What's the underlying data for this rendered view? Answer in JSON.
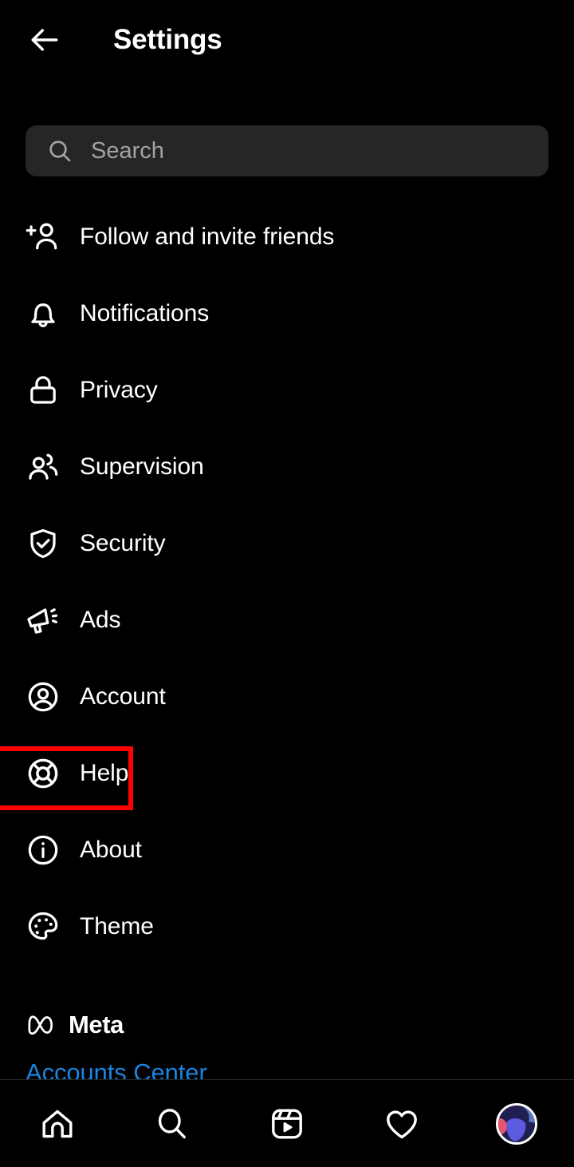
{
  "header": {
    "back_icon": "arrow-left-icon",
    "title": "Settings"
  },
  "search": {
    "icon": "search-icon",
    "value": "",
    "placeholder": "Search"
  },
  "menu": {
    "items": [
      {
        "id": "follow-and-invite-friends",
        "label": "Follow and invite friends",
        "icon": "person-add-icon",
        "highlighted": false
      },
      {
        "id": "notifications",
        "label": "Notifications",
        "icon": "bell-icon",
        "highlighted": false
      },
      {
        "id": "privacy",
        "label": "Privacy",
        "icon": "lock-icon",
        "highlighted": false
      },
      {
        "id": "supervision",
        "label": "Supervision",
        "icon": "people-icon",
        "highlighted": false
      },
      {
        "id": "security",
        "label": "Security",
        "icon": "shield-check-icon",
        "highlighted": false
      },
      {
        "id": "ads",
        "label": "Ads",
        "icon": "megaphone-icon",
        "highlighted": false
      },
      {
        "id": "account",
        "label": "Account",
        "icon": "account-circle-icon",
        "highlighted": false
      },
      {
        "id": "help",
        "label": "Help",
        "icon": "lifebuoy-icon",
        "highlighted": true
      },
      {
        "id": "about",
        "label": "About",
        "icon": "info-circle-icon",
        "highlighted": false
      },
      {
        "id": "theme",
        "label": "Theme",
        "icon": "palette-icon",
        "highlighted": false
      }
    ]
  },
  "footer": {
    "brand_icon": "meta-infinity-icon",
    "brand_label": "Meta",
    "accounts_center_label": "Accounts Center"
  },
  "bottom_nav": {
    "items": [
      {
        "id": "home",
        "icon": "home-icon"
      },
      {
        "id": "search",
        "icon": "search-icon"
      },
      {
        "id": "reels",
        "icon": "reels-icon"
      },
      {
        "id": "activity",
        "icon": "heart-icon"
      },
      {
        "id": "profile",
        "icon": "avatar-icon"
      }
    ]
  },
  "colors": {
    "background": "#000000",
    "search_field": "#262626",
    "text_primary": "#ffffff",
    "placeholder": "#a3a3a3",
    "link_blue": "#1a84e0",
    "highlight_box": "#ff0000",
    "divider": "#262626"
  }
}
